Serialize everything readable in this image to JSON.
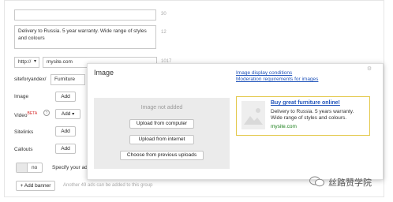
{
  "form": {
    "title_value": "",
    "title_count": "30",
    "text_value": "Delivery to Russia. 5 year warranty. Wide range of styles and colours",
    "text_count": "12",
    "protocol_value": "http://",
    "domain_value": "mysite.com",
    "domain_count": "1017",
    "path_prefix": "siteforyandex/",
    "path_value": "Furniture",
    "image_label": "Image",
    "image_add": "Add",
    "video_label": "Video",
    "video_badge": "BETA",
    "video_add": "Add",
    "sitelinks_label": "Sitelinks",
    "sitelinks_add": "Add",
    "callouts_label": "Callouts",
    "callouts_add": "Add",
    "toggle_label": "no",
    "specify_text": "Specify your ad",
    "add_banner": "+ Add banner",
    "banner_hint": "Another 49 ads can be added to this group"
  },
  "modal": {
    "title": "Image",
    "link1": "Image display conditions",
    "link2": "Moderation requirements for images",
    "not_added": "Image not added",
    "btn_computer": "Upload from computer",
    "btn_internet": "Upload from internet",
    "btn_previous": "Choose from previous uploads"
  },
  "preview": {
    "title": "Buy great furniture online!",
    "text": "Delivery to Russia. 5 years warranty. Wide range of styles and colours.",
    "domain": "mysite.com"
  },
  "watermark": {
    "text": "丝路赞学院"
  },
  "colors": {
    "link": "#2255bb",
    "domain": "#1a7f1a",
    "preview_border": "#e3c84a",
    "beta": "#d52a2a"
  }
}
